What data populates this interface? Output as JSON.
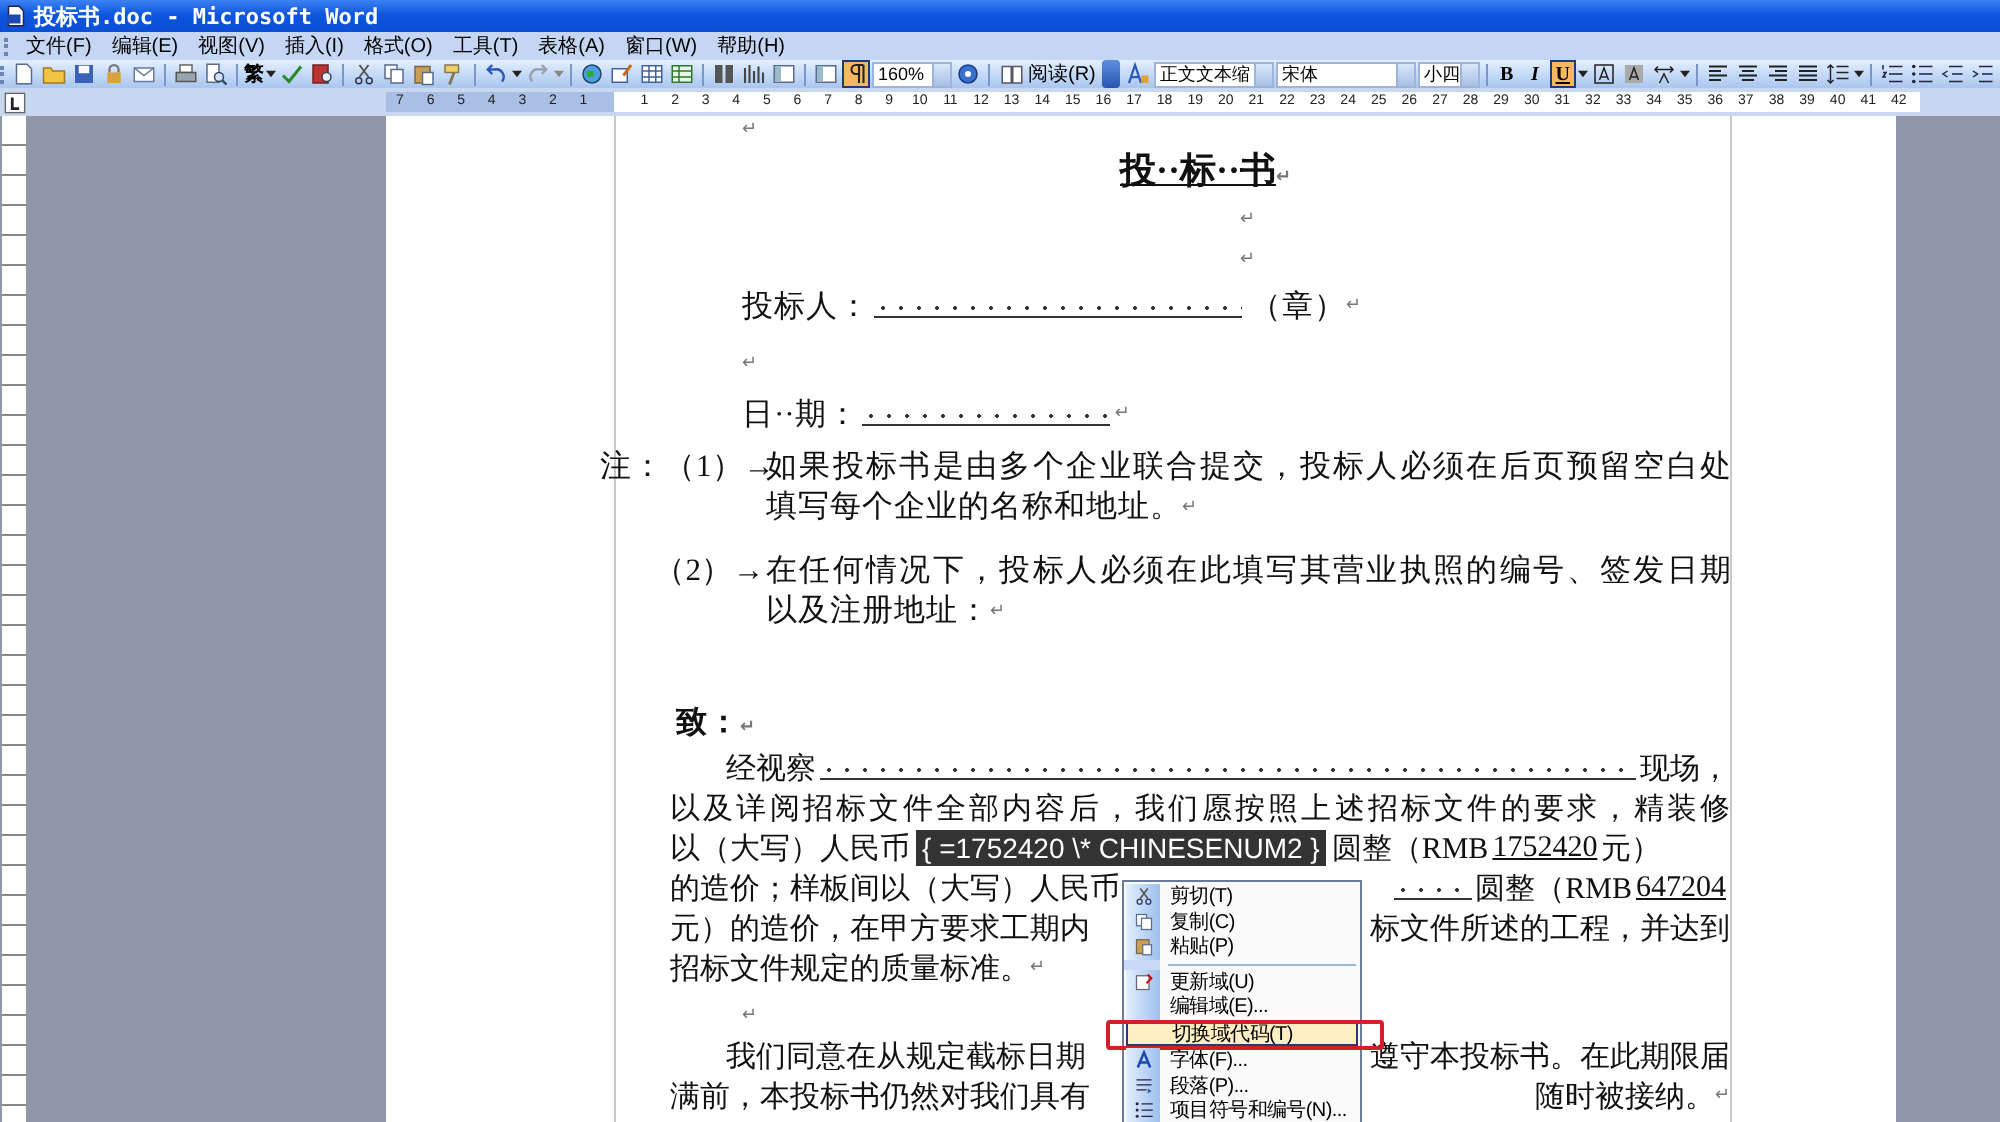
{
  "window": {
    "title": "投标书.doc - Microsoft Word"
  },
  "menu_bar": [
    "文件(F)",
    "编辑(E)",
    "视图(V)",
    "插入(I)",
    "格式(O)",
    "工具(T)",
    "表格(A)",
    "窗口(W)",
    "帮助(H)"
  ],
  "standard_toolbar": {
    "convert_label": "繁",
    "redo_disabled": true,
    "show_marks_pressed": true,
    "zoom": "160%",
    "read_button": "阅读(R)"
  },
  "formatting_toolbar": {
    "style": "正文文本缩",
    "font": "宋体",
    "size": "小四",
    "format_buttons": [
      {
        "label": "B",
        "pressed": false
      },
      {
        "label": "I",
        "pressed": false
      },
      {
        "label": "U",
        "pressed": true
      }
    ]
  },
  "ruler": {
    "left_numbers": [
      "7",
      "6",
      "5",
      "4",
      "3",
      "2",
      "1"
    ],
    "right_numbers": [
      "1",
      "2",
      "3",
      "4",
      "5",
      "6",
      "7",
      "8",
      "9",
      "10",
      "11",
      "12",
      "13",
      "14",
      "15",
      "16",
      "17",
      "18",
      "19",
      "20",
      "21",
      "22",
      "23",
      "24",
      "25",
      "26",
      "27",
      "28",
      "29",
      "30",
      "31",
      "32",
      "33",
      "34",
      "35",
      "36",
      "37",
      "38",
      "39",
      "40",
      "41",
      "42"
    ]
  },
  "document": {
    "paragraphs": [
      {
        "kind": "empty",
        "mark": "↵"
      },
      {
        "kind": "title",
        "text": "投··标··书",
        "mark": "↵"
      },
      {
        "kind": "centered",
        "mark": "↵"
      },
      {
        "kind": "centered",
        "mark": "↵"
      },
      {
        "kind": "form",
        "label": "投标人：",
        "suffix": "（章）",
        "mark": "↵"
      },
      {
        "kind": "empty",
        "mark": "↵"
      },
      {
        "kind": "form",
        "label": "日··期：",
        "mark": "↵"
      },
      {
        "kind": "note",
        "label": "注：（1）→",
        "lines": [
          "如果投标书是由多个企业联合提交，投标人必须在后页预留空白处",
          "填写每个企业的名称和地址。"
        ],
        "mark": "↵"
      },
      {
        "kind": "note",
        "label": "（2）→",
        "lines": [
          "在任何情况下，投标人必须在此填写其营业执照的编号、签发日期",
          "以及注册地址："
        ],
        "mark": "↵"
      },
      {
        "kind": "heading",
        "text": "致：",
        "mark": "↵"
      },
      {
        "kind": "body",
        "mark": "↵",
        "lines": [
          {
            "parts": [
              {
                "kind": "text",
                "text": "经视察"
              },
              {
                "kind": "blank"
              },
              {
                "kind": "text",
                "text": "现场，"
              }
            ]
          },
          {
            "parts": [
              {
                "kind": "text",
                "text": "以及详阅招标文件全部内容后，我们愿按照上述招标文件的要求，精装修"
              }
            ]
          },
          {
            "parts": [
              {
                "kind": "text",
                "text": "以（大写）人民币"
              },
              {
                "kind": "field",
                "text": "{ =1752420 \\* CHINESENUM2 }"
              },
              {
                "kind": "text",
                "text": "圆整（RMB"
              },
              {
                "kind": "underlined",
                "text": "1752420"
              },
              {
                "kind": "text",
                "text": "元）"
              }
            ]
          },
          {
            "parts": [
              {
                "kind": "text",
                "text": "的造价；样板间以（大写）人民币"
              },
              {
                "kind": "hidden"
              },
              {
                "kind": "blank"
              },
              {
                "kind": "text",
                "text": "圆整（RMB"
              },
              {
                "kind": "underlined",
                "text": "647204"
              }
            ]
          },
          {
            "parts": [
              {
                "kind": "text",
                "text": "元）的造价，在甲方要求工期内"
              },
              {
                "kind": "hidden"
              },
              {
                "kind": "text",
                "text": "标文件所述的工程，并达到"
              }
            ]
          },
          {
            "parts": [
              {
                "kind": "text",
                "text": "招标文件规定的质量标准。"
              }
            ]
          }
        ]
      },
      {
        "kind": "empty",
        "mark": "↵"
      },
      {
        "kind": "body",
        "mark": "↵",
        "lines": [
          {
            "parts": [
              {
                "kind": "text",
                "text": "我们同意在从规定截标日期"
              },
              {
                "kind": "hidden"
              },
              {
                "kind": "text",
                "text": "遵守本投标书。在此期限届"
              }
            ]
          },
          {
            "parts": [
              {
                "kind": "text",
                "text": "满前，本投标书仍然对我们具有"
              },
              {
                "kind": "hidden"
              },
              {
                "kind": "text",
                "text": "随时被接纳。"
              }
            ]
          }
        ]
      }
    ]
  },
  "context_menu": {
    "items": [
      {
        "kind": "command",
        "label": "剪切(T)",
        "selected": false,
        "circled": false
      },
      {
        "kind": "command",
        "label": "复制(C)",
        "selected": false,
        "circled": false
      },
      {
        "kind": "command",
        "label": "粘贴(P)",
        "selected": false,
        "circled": false
      },
      {
        "kind": "separator"
      },
      {
        "kind": "command",
        "label": "更新域(U)",
        "selected": false,
        "circled": false
      },
      {
        "kind": "command",
        "label": "编辑域(E)...",
        "selected": false,
        "circled": false
      },
      {
        "kind": "command",
        "label": "切换域代码(T)",
        "selected": true,
        "circled": true
      },
      {
        "kind": "command",
        "label": "字体(F)...",
        "selected": false,
        "circled": false
      },
      {
        "kind": "command",
        "label": "段落(P)...",
        "selected": false,
        "circled": false
      },
      {
        "kind": "command",
        "label": "项目符号和编号(N)...",
        "selected": false,
        "circled": false
      }
    ]
  }
}
